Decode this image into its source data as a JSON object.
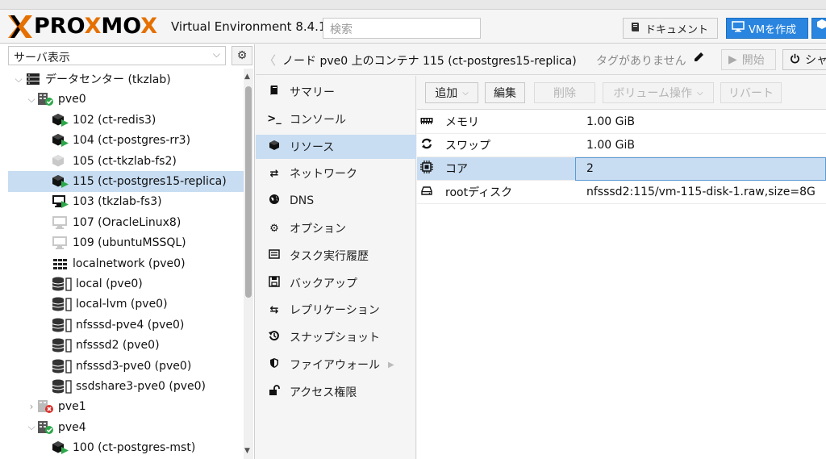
{
  "header": {
    "logo_left": "X",
    "logo_pro": "PRO",
    "logo_x": "X",
    "logo_mo": "MO",
    "logo_x2": "X",
    "title": "Virtual Environment 8.4.1",
    "search_placeholder": "検索",
    "docs_label": "ドキュメント",
    "create_vm_label": "VMを作成",
    "colors": {
      "accent": "#e57000",
      "primary_button": "#2985e0"
    }
  },
  "left_panel": {
    "view_label": "サーバ表示",
    "tree": [
      {
        "label": "データセンター (tkzlab)",
        "icon": "datacenter-icon",
        "level": 0,
        "expanded": true
      },
      {
        "label": "pve0",
        "icon": "node-online-icon",
        "level": 1,
        "expanded": true
      },
      {
        "label": "102 (ct-redis3)",
        "icon": "container-running-icon",
        "level": 2
      },
      {
        "label": "104 (ct-postgres-rr3)",
        "icon": "container-running-icon",
        "level": 2
      },
      {
        "label": "105 (ct-tkzlab-fs2)",
        "icon": "container-stopped-icon",
        "level": 2
      },
      {
        "label": "115 (ct-postgres15-replica)",
        "icon": "container-running-icon",
        "level": 2,
        "selected": true
      },
      {
        "label": "103 (tkzlab-fs3)",
        "icon": "vm-running-icon",
        "level": 2
      },
      {
        "label": "107 (OracleLinux8)",
        "icon": "vm-stopped-icon",
        "level": 2
      },
      {
        "label": "109 (ubuntuMSSQL)",
        "icon": "vm-stopped-icon",
        "level": 2
      },
      {
        "label": "localnetwork (pve0)",
        "icon": "network-grid-icon",
        "level": 2
      },
      {
        "label": "local (pve0)",
        "icon": "storage-icon",
        "level": 2
      },
      {
        "label": "local-lvm (pve0)",
        "icon": "storage-icon",
        "level": 2
      },
      {
        "label": "nfsssd-pve4 (pve0)",
        "icon": "storage-icon",
        "level": 2
      },
      {
        "label": "nfsssd2 (pve0)",
        "icon": "storage-icon",
        "level": 2
      },
      {
        "label": "nfsssd3-pve0 (pve0)",
        "icon": "storage-icon",
        "level": 2
      },
      {
        "label": "ssdshare3-pve0 (pve0)",
        "icon": "storage-icon",
        "level": 2
      },
      {
        "label": "pve1",
        "icon": "node-offline-icon",
        "level": 1,
        "expanded": false
      },
      {
        "label": "pve4",
        "icon": "node-online-icon",
        "level": 1,
        "expanded": true
      },
      {
        "label": "100 (ct-postgres-mst)",
        "icon": "container-running-icon",
        "level": 2
      }
    ]
  },
  "title_bar": {
    "title": "ノード pve0 上のコンテナ 115 (ct-postgres15-replica)",
    "tags": "タグがありません",
    "start_label": "開始",
    "shutdown_label": "シャ"
  },
  "menu": {
    "items": [
      {
        "label": "サマリー",
        "icon": "book-icon"
      },
      {
        "label": "コンソール",
        "icon": "terminal-icon"
      },
      {
        "label": "リソース",
        "icon": "cube-icon",
        "selected": true
      },
      {
        "label": "ネットワーク",
        "icon": "exchange-icon"
      },
      {
        "label": "DNS",
        "icon": "globe-icon"
      },
      {
        "label": "オプション",
        "icon": "gear-icon"
      },
      {
        "label": "タスク実行履歴",
        "icon": "list-icon"
      },
      {
        "label": "バックアップ",
        "icon": "floppy-icon"
      },
      {
        "label": "レプリケーション",
        "icon": "retweet-icon"
      },
      {
        "label": "スナップショット",
        "icon": "history-icon"
      },
      {
        "label": "ファイアウォール",
        "icon": "shield-icon",
        "has_submenu": true
      },
      {
        "label": "アクセス権限",
        "icon": "unlock-icon"
      }
    ]
  },
  "toolbar": {
    "add_label": "追加",
    "edit_label": "編集",
    "remove_label": "削除",
    "volume_action_label": "ボリューム操作",
    "revert_label": "リバート"
  },
  "resources": {
    "rows": [
      {
        "name": "メモリ",
        "value": "1.00 GiB",
        "icon": "memory-icon"
      },
      {
        "name": "スワップ",
        "value": "1.00 GiB",
        "icon": "refresh-icon"
      },
      {
        "name": "コア",
        "value": "2",
        "icon": "cpu-icon",
        "selected": true
      },
      {
        "name": "rootディスク",
        "value": "nfsssd2:115/vm-115-disk-1.raw,size=8G",
        "icon": "hdd-icon"
      }
    ]
  }
}
